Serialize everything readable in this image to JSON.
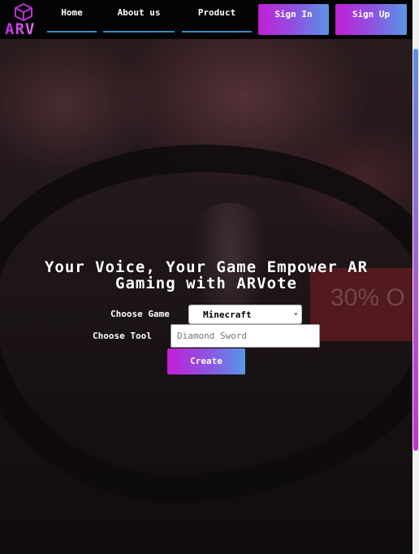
{
  "logo": {
    "text": "ARV",
    "icon": "cube-icon"
  },
  "nav": {
    "home": "Home",
    "about": "About us",
    "product": "Product",
    "sign_in": "Sign In",
    "sign_up": "Sign Up"
  },
  "hero": {
    "title": "Your Voice, Your Game Empower AR Gaming with ARVote",
    "background_sign_text": "30% O"
  },
  "form": {
    "game_label": "Choose Game",
    "game_selected": "Minecraft",
    "tool_label": "Choose Tool",
    "tool_placeholder": "Diamond Sword",
    "create_label": "Create"
  },
  "colors": {
    "gradient_start": "#c11fd6",
    "gradient_end": "#5897e6",
    "nav_underline": "#2b8fc0",
    "navbar_bg": "#050405"
  }
}
